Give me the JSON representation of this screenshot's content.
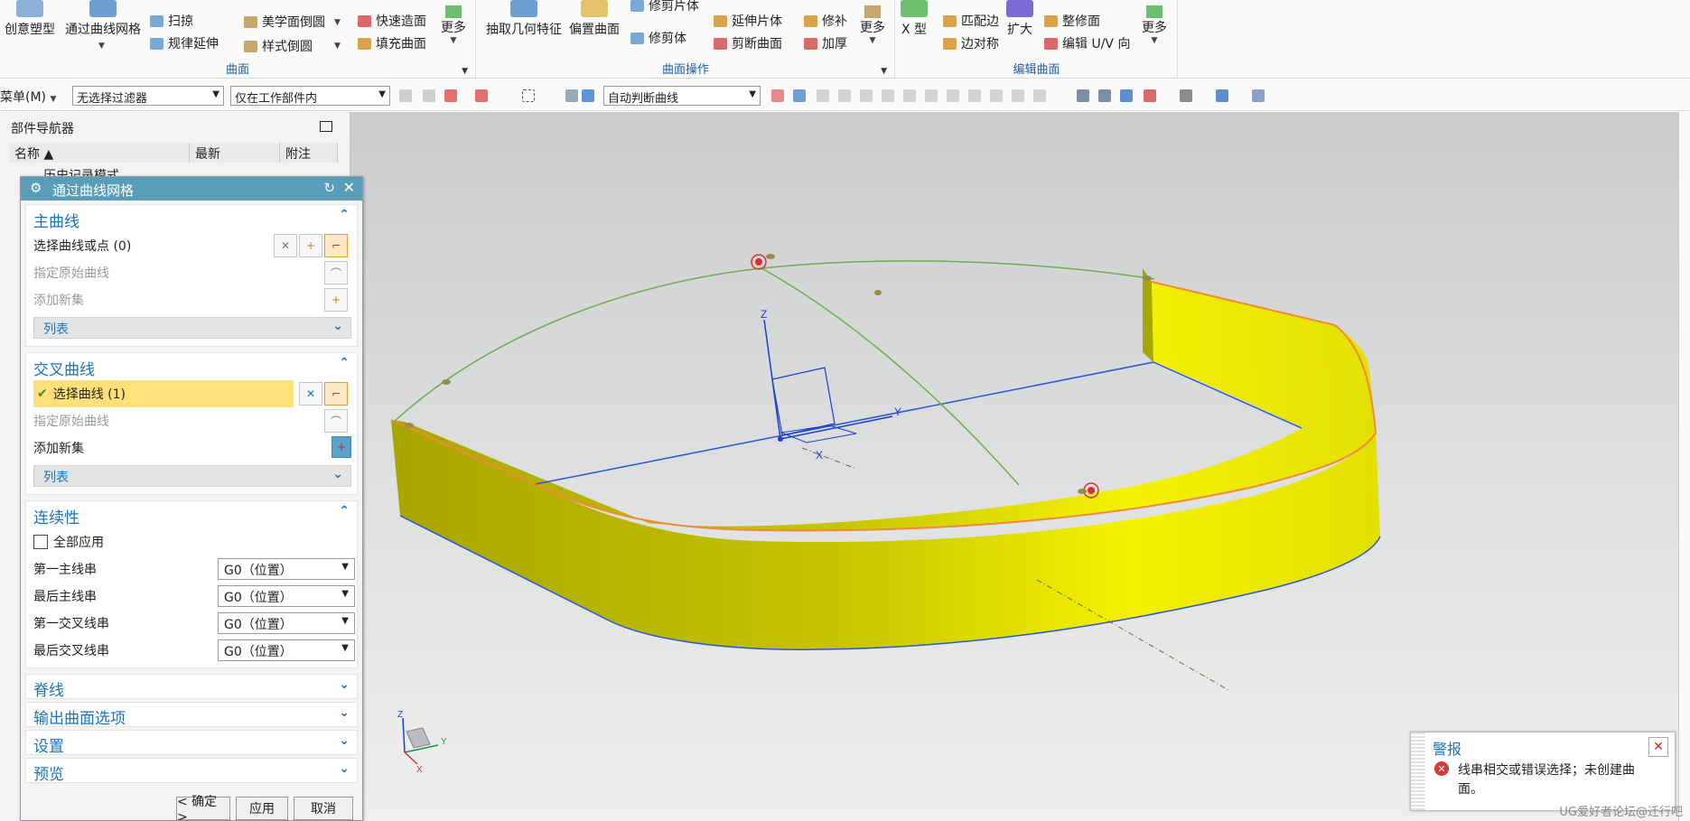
{
  "ribbon": {
    "group1": {
      "big": [
        "创意塑型",
        "通过曲线网格"
      ],
      "small": [
        "扫掠",
        "规律延伸",
        "美学面倒圆",
        "样式倒圆",
        "快速造面",
        "填充曲面"
      ],
      "more": "更多",
      "label": "曲面"
    },
    "group2": {
      "big": [
        "抽取几何特征",
        "偏置曲面"
      ],
      "small": [
        "修剪片体",
        "修剪体",
        "延伸片体",
        "剪断曲面",
        "修补",
        "加厚"
      ],
      "more": "更多",
      "label": "曲面操作"
    },
    "group3": {
      "big": [
        "X 型",
        "扩大"
      ],
      "small": [
        "匹配边",
        "边对称",
        "整修面",
        "编辑 U/V 向"
      ],
      "more": "更多",
      "label": "编辑曲面"
    }
  },
  "toolbar": {
    "menu": "菜单(M)",
    "filter": "无选择过滤器",
    "scope": "仅在工作部件内",
    "curve_rule": "自动判断曲线"
  },
  "navigator": {
    "title": "部件导航器",
    "columns": [
      "名称",
      "最新",
      "附注"
    ],
    "first_item": "历史记录模式"
  },
  "dialog": {
    "title": "通过曲线网格",
    "primary": {
      "heading": "主曲线",
      "select": "选择曲线或点 (0)",
      "specify": "指定原始曲线",
      "add_set": "添加新集",
      "list": "列表"
    },
    "cross": {
      "heading": "交叉曲线",
      "select": "选择曲线 (1)",
      "specify": "指定原始曲线",
      "add_set": "添加新集",
      "list": "列表"
    },
    "continuity": {
      "heading": "连续性",
      "apply_all": "全部应用",
      "rows": [
        {
          "label": "第一主线串",
          "value": "G0（位置）"
        },
        {
          "label": "最后主线串",
          "value": "G0（位置）"
        },
        {
          "label": "第一交叉线串",
          "value": "G0（位置）"
        },
        {
          "label": "最后交叉线串",
          "value": "G0（位置）"
        }
      ]
    },
    "collapsed": [
      "脊线",
      "输出曲面选项",
      "设置",
      "预览"
    ],
    "ok": "< 确定 >",
    "apply": "应用",
    "cancel": "取消"
  },
  "viewport": {
    "axis_z": "Z",
    "axis_y": "Y",
    "axis_x": "X",
    "triad_z": "Z",
    "triad_y": "Y",
    "triad_x": "X"
  },
  "alert": {
    "title": "警报",
    "message": "线串相交或错误选择；未创建曲面。"
  },
  "watermark": "UG爱好者论坛@迁行吧",
  "colors": {
    "accent": "#1a74b8",
    "title_bar": "#5a9db8",
    "highlight": "#ffe07a",
    "surface": "#f2f200",
    "curve": "#6fae4c"
  }
}
